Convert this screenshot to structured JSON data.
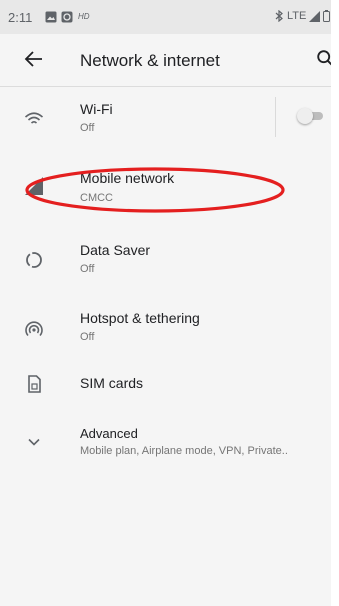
{
  "status_bar": {
    "time": "2:11",
    "hd_label": "HD",
    "network_label": "LTE"
  },
  "app_bar": {
    "title": "Network & internet"
  },
  "items": [
    {
      "title": "Wi-Fi",
      "subtitle": "Off",
      "icon": "wifi-icon",
      "toggle_on": false
    },
    {
      "title": "Mobile network",
      "subtitle": "CMCC",
      "icon": "cellular-signal-icon"
    },
    {
      "title": "Data Saver",
      "subtitle": "Off",
      "icon": "data-saver-icon"
    },
    {
      "title": "Hotspot & tethering",
      "subtitle": "Off",
      "icon": "hotspot-icon"
    },
    {
      "title": "SIM cards",
      "icon": "sim-card-icon"
    },
    {
      "title": "Advanced",
      "subtitle": "Mobile plan, Airplane mode, VPN, Private..",
      "icon": "chevron-down-icon"
    }
  ],
  "colors": {
    "annotation": "#e41f1f",
    "background": "#f5f5f5",
    "status_bar": "#e8e8e8"
  }
}
